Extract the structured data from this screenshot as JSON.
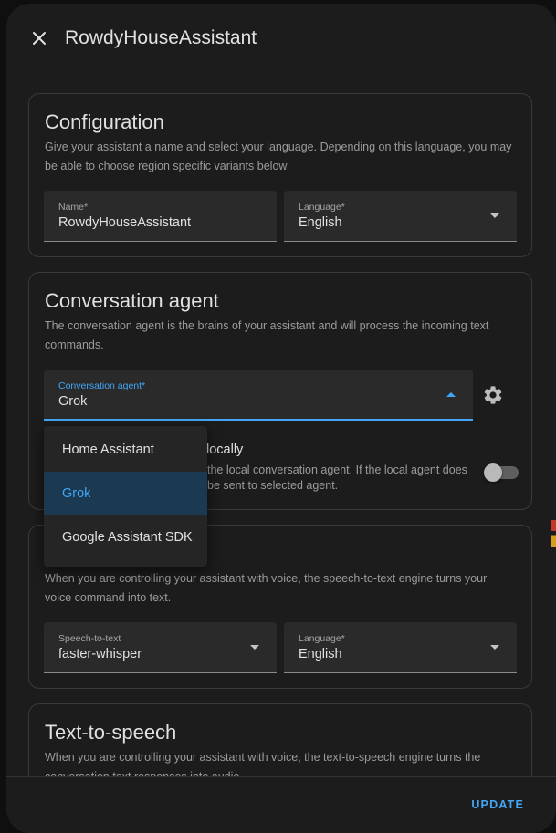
{
  "dialog": {
    "title": "RowdyHouseAssistant",
    "close_icon": "close-icon"
  },
  "configuration": {
    "title": "Configuration",
    "description": "Give your assistant a name and select your language. Depending on this language, you may be able to choose region specific variants below.",
    "name_field": {
      "label": "Name*",
      "value": "RowdyHouseAssistant"
    },
    "language_field": {
      "label": "Language*",
      "value": "English"
    }
  },
  "conversation": {
    "title": "Conversation agent",
    "description": "The conversation agent is the brains of your assistant and will process the incoming text commands.",
    "agent_field": {
      "label": "Conversation agent*",
      "value": "Grok"
    },
    "settings_icon": "gear-icon",
    "prefer_local": {
      "title_visible": "locally",
      "desc_line1_visible": "the local conversation agent. If the local agent does",
      "desc_line2_visible": "be sent to selected agent."
    }
  },
  "agent_menu": {
    "items": [
      {
        "label": "Home Assistant"
      },
      {
        "label": "Grok"
      },
      {
        "label": "Google Assistant SDK"
      }
    ]
  },
  "stt": {
    "description": "When you are controlling your assistant with voice, the speech-to-text engine turns your voice command into text.",
    "engine_field": {
      "label": "Speech-to-text",
      "value": "faster-whisper"
    },
    "language_field": {
      "label": "Language*",
      "value": "English"
    }
  },
  "tts": {
    "title": "Text-to-speech",
    "description": "When you are controlling your assistant with voice, the text-to-speech engine turns the conversation text responses into audio."
  },
  "footer": {
    "update_label": "UPDATE"
  },
  "colors": {
    "accent": "#42a5f5",
    "surface": "#1c1c1c",
    "field": "#2a2a2a"
  }
}
